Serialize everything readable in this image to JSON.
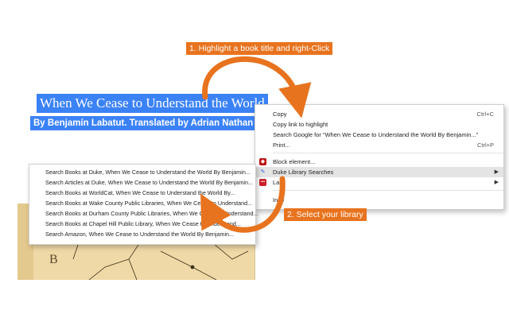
{
  "page": {
    "title_selection": "When We Cease to Understand the World",
    "byline_selection": "By Benjamín Labatut. Translated by Adrian Nathan We"
  },
  "cover": {
    "letter": "B"
  },
  "callouts": {
    "step1": "1. Highlight a book title and right-Click",
    "step2": "2. Select your library"
  },
  "context_menu": {
    "items": [
      {
        "label": "Copy",
        "shortcut": "Ctrl+C"
      },
      {
        "label": "Copy link to highlight",
        "shortcut": ""
      },
      {
        "label": "Search Google for “When We Cease to Understand the World By Benjamin...”",
        "shortcut": ""
      },
      {
        "label": "Print...",
        "shortcut": "Ctrl+P"
      },
      {
        "label": "Block element...",
        "shortcut": "",
        "icon": "ublock-icon"
      },
      {
        "label": "Duke Library Searches",
        "shortcut": "",
        "icon": "duke-extension-icon",
        "has_submenu": true
      },
      {
        "label": "Last",
        "shortcut": "",
        "icon": "lastpass-icon",
        "has_submenu": true
      },
      {
        "label": "Insp",
        "shortcut": ""
      }
    ]
  },
  "submenu": {
    "items": [
      "Search Books at Duke, When We Cease to Understand the World By Benjamin...",
      "Search Articles at Duke, When We Cease to Understand the World By Benjamin...",
      "Search Books at WorldCat, When We Cease to Understand the World By...",
      "Search Books at Wake County Public Libraries, When We Cease to Understand...",
      "Search Books at Durham County Public Libraries, When We Cease to Understand...",
      "Search Books at Chapel Hill Public Library, When We Cease to Understand...",
      "Search Amazon, When We Cease to Understand the World By Benjamin..."
    ]
  },
  "colors": {
    "selection": "#3b82f6",
    "callout": "#e8731e",
    "arrow": "#e8731e"
  }
}
